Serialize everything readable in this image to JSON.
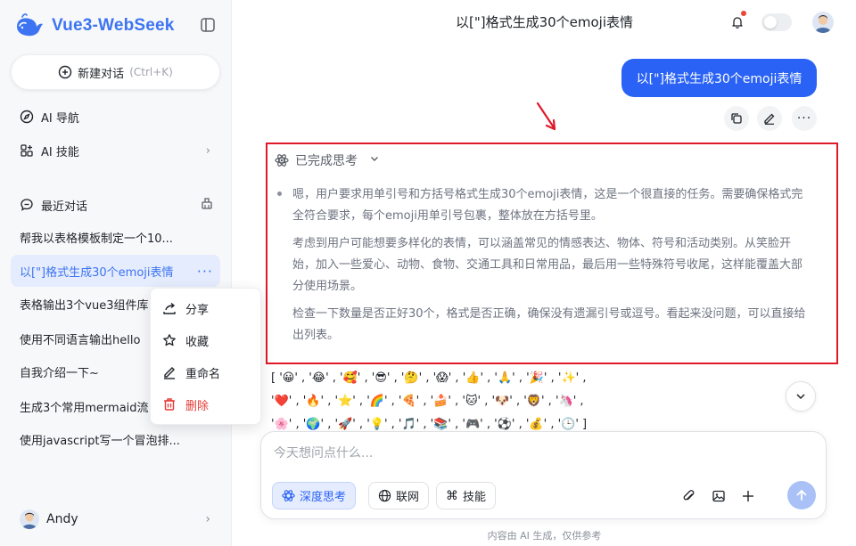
{
  "app": {
    "name": "Vue3-WebSeek",
    "brand_color": "#3d74f2"
  },
  "sidebar": {
    "new_chat_label": "新建对话",
    "new_chat_shortcut": "(Ctrl+K)",
    "nav": [
      {
        "label": "AI 导航",
        "icon": "compass-icon"
      },
      {
        "label": "AI 技能",
        "icon": "grid-plus-icon"
      }
    ],
    "recent_label": "最近对话",
    "history": [
      {
        "title": "帮我以表格模板制定一个10...",
        "active": false
      },
      {
        "title": "以[\"]格式生成30个emoji表情",
        "active": true
      },
      {
        "title": "表格输出3个vue3组件库",
        "active": false
      },
      {
        "title": "使用不同语言输出hello",
        "active": false
      },
      {
        "title": "自我介绍一下~",
        "active": false
      },
      {
        "title": "生成3个常用mermaid流",
        "active": false
      },
      {
        "title": "使用javascript写一个冒泡排...",
        "active": false
      }
    ],
    "user_name": "Andy"
  },
  "context_menu": {
    "items": [
      {
        "label": "分享",
        "icon": "share-icon"
      },
      {
        "label": "收藏",
        "icon": "star-icon"
      },
      {
        "label": "重命名",
        "icon": "edit-icon"
      },
      {
        "label": "删除",
        "icon": "trash-icon",
        "danger": true
      }
    ]
  },
  "header": {
    "title": "以[\"]格式生成30个emoji表情"
  },
  "conversation": {
    "user_message": "以[\"]格式生成30个emoji表情",
    "thinking_label": "已完成思考",
    "thinking_paragraphs": [
      "嗯，用户要求用单引号和方括号格式生成30个emoji表情，这是一个很直接的任务。需要确保格式完全符合要求，每个emoji用单引号包裹，整体放在方括号里。",
      "考虑到用户可能想要多样化的表情，可以涵盖常见的情感表达、物体、符号和活动类别。从笑脸开始，加入一些爱心、动物、食物、交通工具和日常用品，最后用一些特殊符号收尾，这样能覆盖大部分使用场景。",
      "检查一下数量是否正好30个，格式是否正确，确保没有遗漏引号或逗号。看起来没问题，可以直接给出列表。"
    ],
    "emoji_lines": [
      "[ '😀' , '😂' , '🥰' , '😎' , '🤔' , '😱' , '👍' , '🙏' , '🎉' , '✨' ,",
      " '❤️' , '🔥' , '⭐' , '🌈' , '🍕' , '🍰' , '🐱' , '🐶' , '🦁' , '🦄' ,",
      " '🌸' , '🌍' , '🚀' , '💡' , '🎵' , '📚' , '🎮' , '⚽' , '💰' , '🕒' ]"
    ]
  },
  "composer": {
    "placeholder": "今天想问点什么...",
    "chips": [
      {
        "label": "深度思考",
        "icon": "atom-icon",
        "active": true
      },
      {
        "label": "联网",
        "icon": "globe-icon",
        "active": false
      },
      {
        "label": "技能",
        "icon": "command-icon",
        "active": false
      }
    ]
  },
  "footer_note": "内容由 AI 生成，仅供参考"
}
